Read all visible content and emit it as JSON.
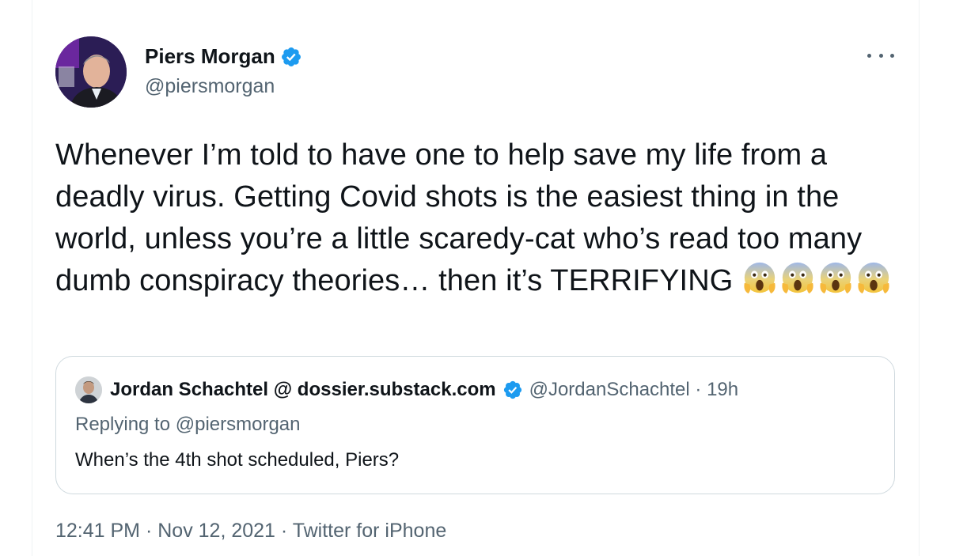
{
  "author": {
    "name": "Piers Morgan",
    "handle": "@piersmorgan",
    "verified_icon": "verified-badge-icon"
  },
  "tweet": {
    "text": "Whenever I’m told to have one to help save my life from a deadly virus. Getting Covid shots is the easiest thing in the world, unless you’re a little scaredy-cat who’s read too many dumb conspiracy theories… then it’s TERRIFYING",
    "emoji_count": 4,
    "emoji_name": "face-screaming-in-fear-icon"
  },
  "quoted": {
    "name": "Jordan Schachtel @ dossier.substack.com",
    "handle_time": "@JordanSchachtel · 19h",
    "replying": "Replying to @piersmorgan",
    "text": "When’s the 4th shot scheduled, Piers?"
  },
  "meta": {
    "time": "12:41 PM",
    "sep1": " · ",
    "date": "Nov 12, 2021",
    "sep2": " · ",
    "source": "Twitter for iPhone"
  },
  "colors": {
    "verified": "#1d9bf0",
    "secondary_text": "#536471",
    "primary_text": "#0f1419",
    "border": "#cfd9de"
  }
}
